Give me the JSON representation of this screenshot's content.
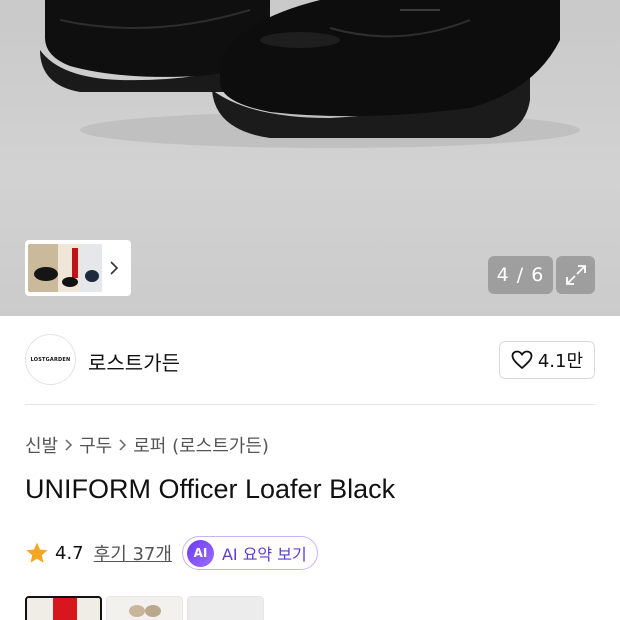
{
  "gallery": {
    "counter": "4 / 6",
    "icons": {
      "expand": "expand-icon",
      "next": "chevron-right-icon"
    }
  },
  "brand": {
    "logo_text": "LOSTGARDEN",
    "name": "로스트가든",
    "likes": "4.1만",
    "like_icon": "heart-icon"
  },
  "breadcrumb": [
    "신발",
    "구두",
    "로퍼 (로스트가든)"
  ],
  "product": {
    "title": "UNIFORM Officer Loafer Black"
  },
  "rating": {
    "score": "4.7",
    "reviews": "후기 37개",
    "ai_badge": "AI",
    "ai_summary": "AI 요약 보기",
    "star_color": "#f5a623"
  },
  "colors": {
    "accent": "#6b3df0",
    "ai_text": "#5c3cd6"
  }
}
